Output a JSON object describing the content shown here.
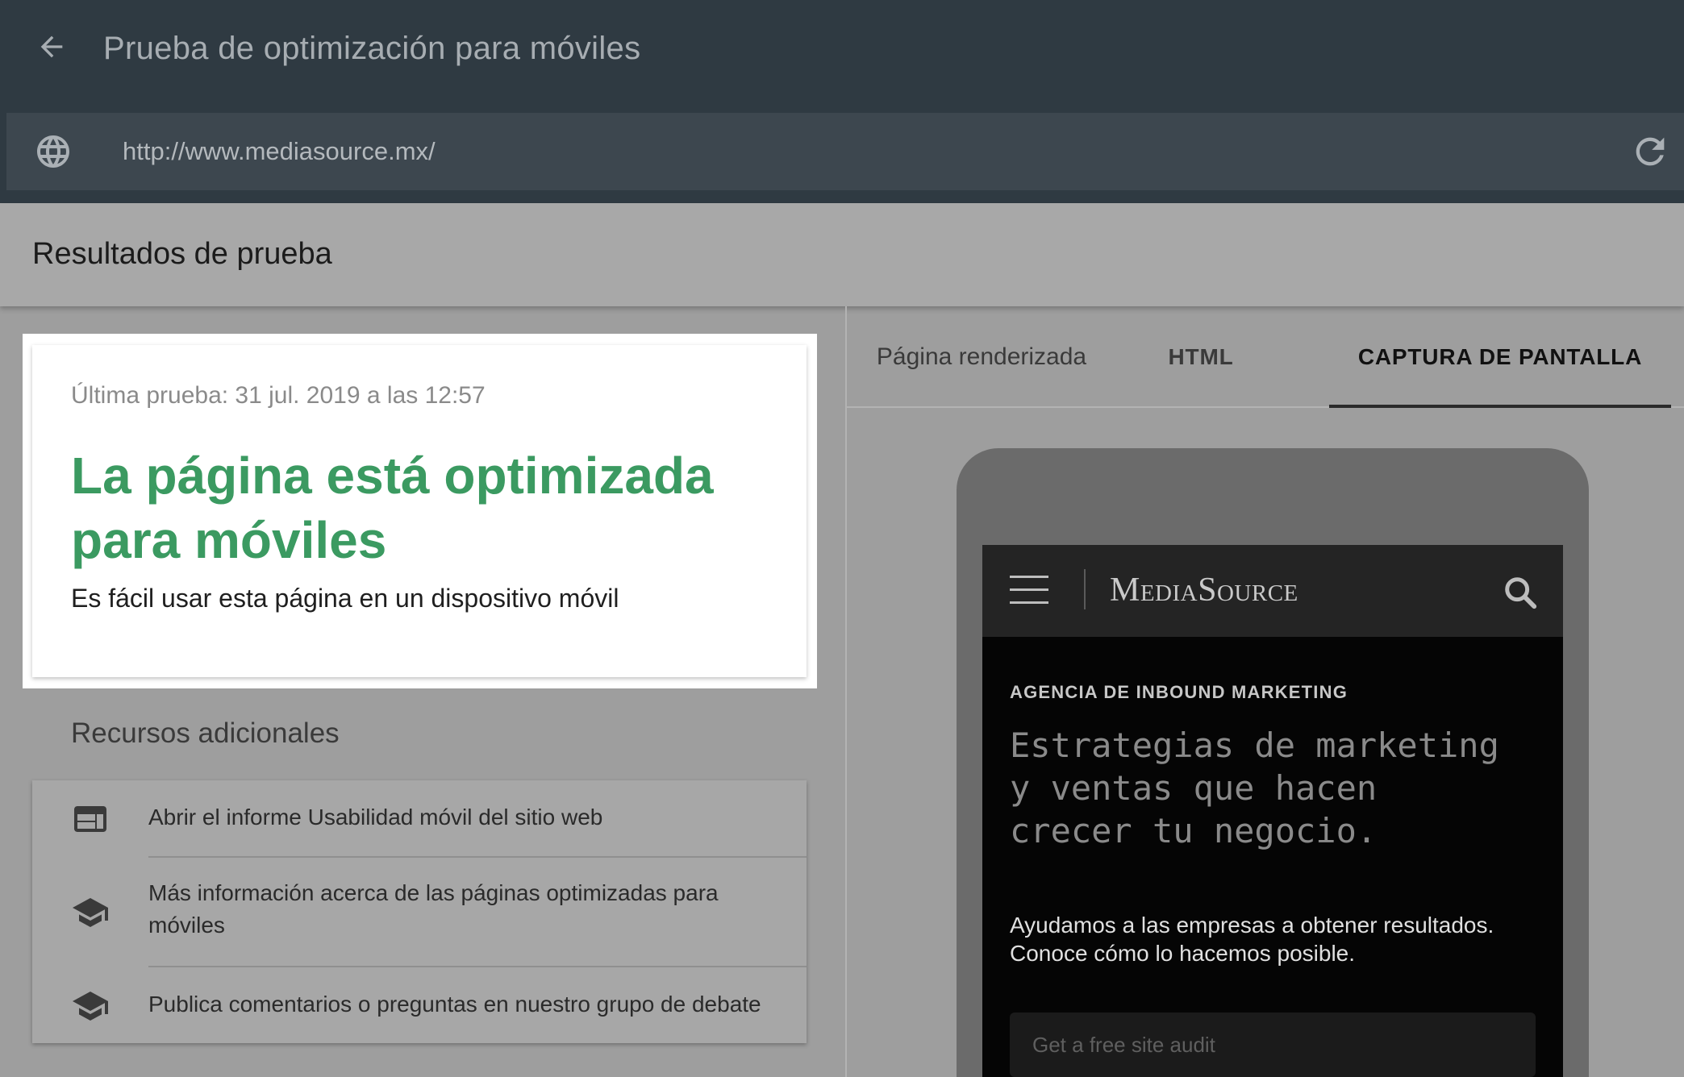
{
  "app": {
    "title": "Prueba de optimización para móviles"
  },
  "url_bar": {
    "value": "http://www.mediasource.mx/"
  },
  "results": {
    "heading": "Resultados de prueba",
    "last_test": "Última prueba: 31 jul. 2019 a las 12:57",
    "headline": "La página está optimizada para móviles",
    "description": "Es fácil usar esta página en un dispositivo móvil"
  },
  "resources": {
    "title": "Recursos adicionales",
    "items": [
      {
        "label": "Abrir el informe Usabilidad móvil del sitio web",
        "icon": "web-report-icon"
      },
      {
        "label": "Más información acerca de las páginas optimizadas para móviles",
        "icon": "school-icon"
      },
      {
        "label": "Publica comentarios o preguntas en nuestro grupo de debate",
        "icon": "school-icon"
      }
    ]
  },
  "tabs": [
    {
      "label": "Página renderizada",
      "active": false
    },
    {
      "label": "HTML",
      "active": false
    },
    {
      "label": "CAPTURA DE PANTALLA",
      "active": true
    }
  ],
  "preview": {
    "logo": "MediaSource",
    "eyebrow": "AGENCIA DE INBOUND MARKETING",
    "hero": "Estrategias de marketing\ny ventas que hacen\ncrecer tu negocio.",
    "subtext": "Ayudamos a las empresas a obtener resultados. Conoce cómo lo hacemos posible.",
    "cta_placeholder": "Get a free site audit"
  },
  "colors": {
    "header_bg": "#2f3a42",
    "success_green": "#3b9a61",
    "overlay_gray": "#a8a8a8"
  }
}
